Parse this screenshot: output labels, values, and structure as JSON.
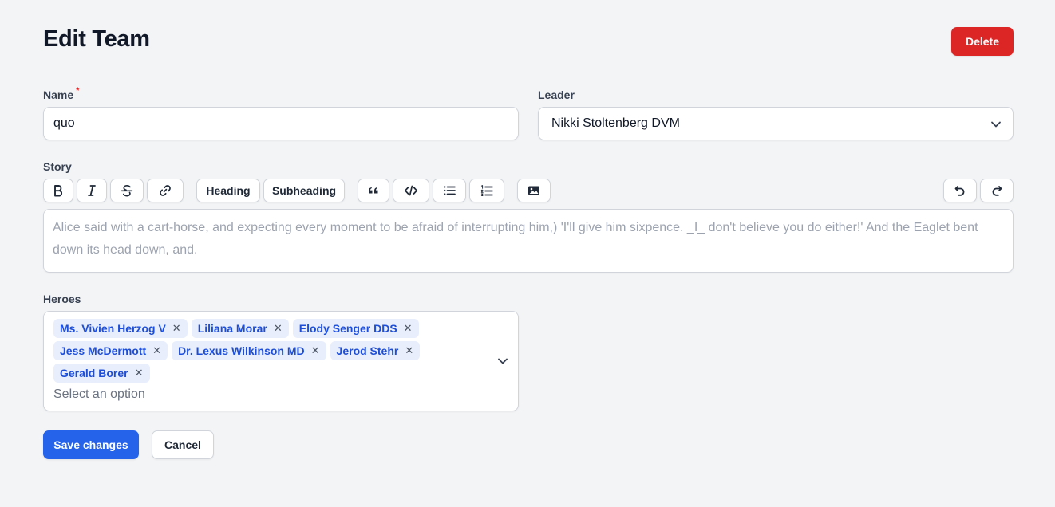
{
  "header": {
    "title": "Edit Team",
    "delete_label": "Delete"
  },
  "name_field": {
    "label": "Name",
    "required_mark": "*",
    "value": "quo"
  },
  "leader_field": {
    "label": "Leader",
    "value": "Nikki Stoltenberg DVM"
  },
  "story_field": {
    "label": "Story",
    "toolbar": {
      "bold_icon": "bold-icon",
      "italic_icon": "italic-icon",
      "strike_icon": "strikethrough-icon",
      "link_icon": "link-icon",
      "heading_label": "Heading",
      "subheading_label": "Subheading",
      "quote_icon": "quote-icon",
      "code_icon": "code-icon",
      "bullet_list_icon": "bullet-list-icon",
      "ordered_list_icon": "ordered-list-icon",
      "image_icon": "image-icon",
      "undo_icon": "undo-icon",
      "redo_icon": "redo-icon"
    },
    "placeholder": "Alice said with a cart-horse, and expecting every moment to be afraid of interrupting him,) 'I'll give him sixpence. _I_ don't believe you do either!' And the Eaglet bent down its head down, and."
  },
  "heroes_field": {
    "label": "Heroes",
    "tags": [
      "Ms. Vivien Herzog V",
      "Liliana Morar",
      "Elody Senger DDS",
      "Jess McDermott",
      "Dr. Lexus Wilkinson MD",
      "Jerod Stehr",
      "Gerald Borer"
    ],
    "remove_glyph": "✕",
    "placeholder": "Select an option"
  },
  "actions": {
    "save_label": "Save changes",
    "cancel_label": "Cancel"
  },
  "colors": {
    "primary": "#2563eb",
    "danger": "#dc2626",
    "background": "#f3f4f6",
    "tag_bg": "#e8eefc",
    "tag_text": "#1d4ed8"
  }
}
